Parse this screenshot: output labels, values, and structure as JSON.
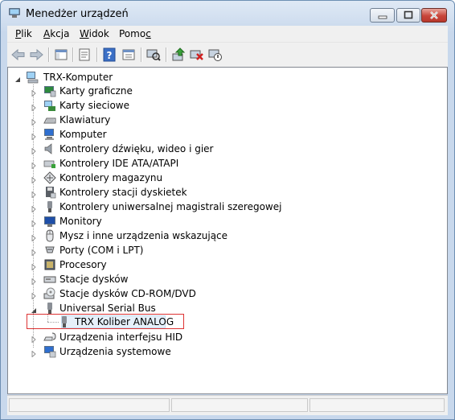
{
  "window": {
    "title": "Menedżer urządzeń"
  },
  "menu": [
    {
      "label": "Plik",
      "accel": "P",
      "rest": "lik"
    },
    {
      "label": "Akcja",
      "accel": "A",
      "rest": "kcja"
    },
    {
      "label": "Widok",
      "accel": "W",
      "rest": "idok"
    },
    {
      "label": "Pomoc",
      "accel_pre": "Pomo",
      "accel": "c"
    }
  ],
  "toolbar_icons": [
    "back-arrow-icon",
    "forward-arrow-icon",
    "console-tree-icon",
    "properties-icon",
    "help-icon",
    "view-icon",
    "scan-hardware-icon",
    "update-driver-icon",
    "uninstall-icon",
    "disable-device-icon"
  ],
  "tree": {
    "root": "TRX-Komputer",
    "categories": [
      {
        "label": "Karty graficzne",
        "icon": "display-adapter-icon"
      },
      {
        "label": "Karty sieciowe",
        "icon": "network-adapter-icon"
      },
      {
        "label": "Klawiatury",
        "icon": "keyboard-icon"
      },
      {
        "label": "Komputer",
        "icon": "computer-icon"
      },
      {
        "label": "Kontrolery dźwięku, wideo i gier",
        "icon": "speaker-icon"
      },
      {
        "label": "Kontrolery IDE ATA/ATAPI",
        "icon": "ide-controller-icon"
      },
      {
        "label": "Kontrolery magazynu",
        "icon": "storage-controller-icon"
      },
      {
        "label": "Kontrolery stacji dyskietek",
        "icon": "floppy-controller-icon"
      },
      {
        "label": "Kontrolery uniwersalnej magistrali szeregowej",
        "icon": "usb-controller-icon"
      },
      {
        "label": "Monitory",
        "icon": "monitor-icon"
      },
      {
        "label": "Mysz i inne urządzenia wskazujące",
        "icon": "mouse-icon"
      },
      {
        "label": "Porty (COM i LPT)",
        "icon": "port-icon"
      },
      {
        "label": "Procesory",
        "icon": "processor-icon"
      },
      {
        "label": "Stacje dysków",
        "icon": "disk-drive-icon"
      },
      {
        "label": "Stacje dysków CD-ROM/DVD",
        "icon": "cdrom-icon"
      },
      {
        "label": "Universal Serial Bus",
        "icon": "usb-icon"
      },
      {
        "label": "Urządzenia interfejsu HID",
        "icon": "hid-icon"
      },
      {
        "label": "Urządzenia systemowe",
        "icon": "system-device-icon"
      }
    ],
    "expanded_child": {
      "label": "TRX Koliber ANALOG",
      "icon": "usb-device-icon"
    }
  },
  "colors": {
    "highlight_box": "#dd3333",
    "selection_bg": "#e6f0fa"
  }
}
